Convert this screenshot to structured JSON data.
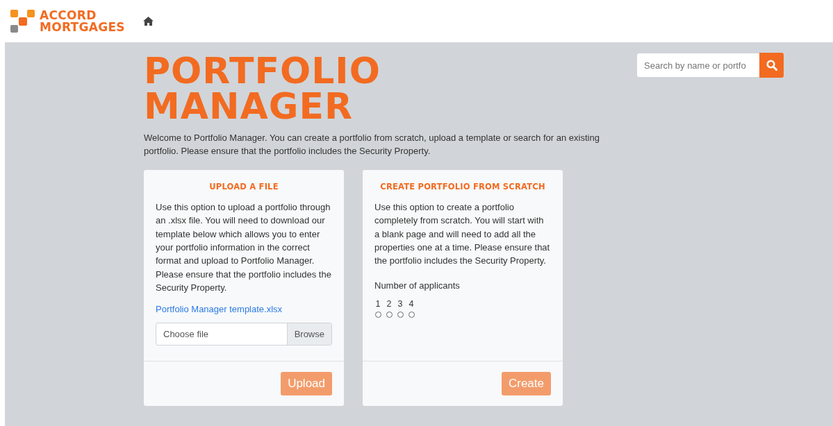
{
  "header": {
    "logo_lines": [
      "ACCORD",
      "MORTGAGES"
    ]
  },
  "search": {
    "placeholder": "Search by name or portfo"
  },
  "title_lines": [
    "PORTFOLIO",
    "MANAGER"
  ],
  "intro": "Welcome to Portfolio Manager. You can create a portfolio from scratch, upload a template or search for an existing portfolio. Please ensure that the portfolio includes the Security Property.",
  "cards": [
    {
      "kind": "upload",
      "title": "UPLOAD A FILE",
      "text": "Use this option to upload a portfolio through an .xlsx file. You will need to download our template below which allows you to enter your portfolio information in the correct format and upload to Portfolio Manager. Please ensure that the portfolio includes the Security Property.",
      "link": "Portfolio Manager template.xlsx",
      "file_placeholder": "Choose file",
      "browse": "Browse",
      "button": {
        "label": "Upload",
        "disabled": true
      }
    },
    {
      "kind": "create",
      "title": "CREATE PORTFOLIO FROM SCRATCH",
      "text": "Use this option to create a portfolio completely from scratch. You will start with a blank page and will need to add all the properties one at a time. Please ensure that the portfolio includes the Security Property.",
      "field_label": "Number of applicants",
      "options": [
        {
          "label": "1",
          "selected": false
        },
        {
          "label": "2",
          "selected": false
        },
        {
          "label": "3",
          "selected": false
        },
        {
          "label": "4",
          "selected": false
        }
      ],
      "button": {
        "label": "Create",
        "disabled": true
      }
    }
  ]
}
